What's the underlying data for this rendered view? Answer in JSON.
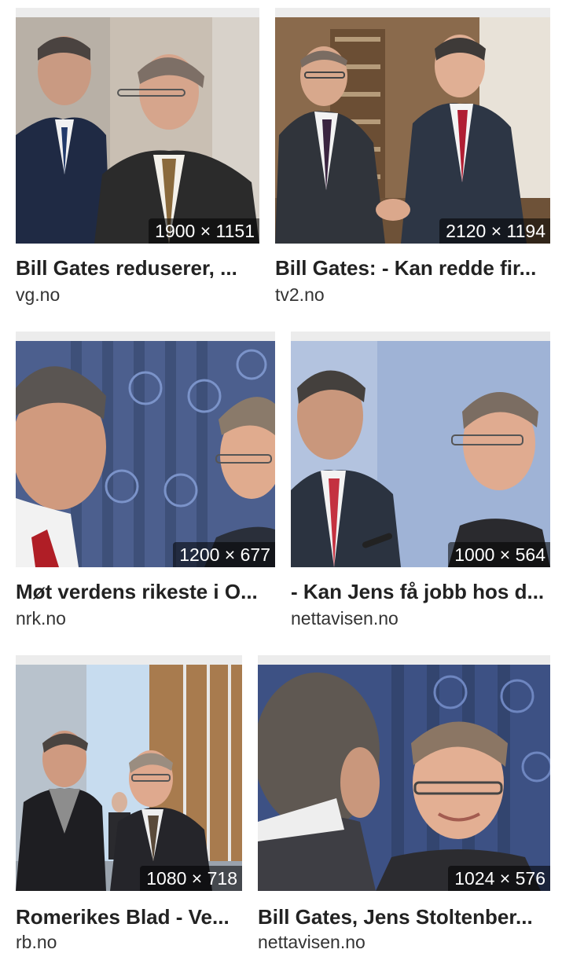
{
  "results": [
    {
      "title": "Bill Gates reduserer, ...",
      "source": "vg.no",
      "dimensions": "1900 × 1151"
    },
    {
      "title": "Bill Gates: - Kan redde fir...",
      "source": "tv2.no",
      "dimensions": "2120 × 1194"
    },
    {
      "title": "Møt verdens rikeste i O...",
      "source": "nrk.no",
      "dimensions": "1200 × 677"
    },
    {
      "title": "- Kan Jens få jobb hos d...",
      "source": "nettavisen.no",
      "dimensions": "1000 × 564"
    },
    {
      "title": "Romerikes Blad - Ve...",
      "source": "rb.no",
      "dimensions": "1080 × 718"
    },
    {
      "title": "Bill Gates, Jens Stoltenber...",
      "source": "nettavisen.no",
      "dimensions": "1024 × 576"
    }
  ]
}
